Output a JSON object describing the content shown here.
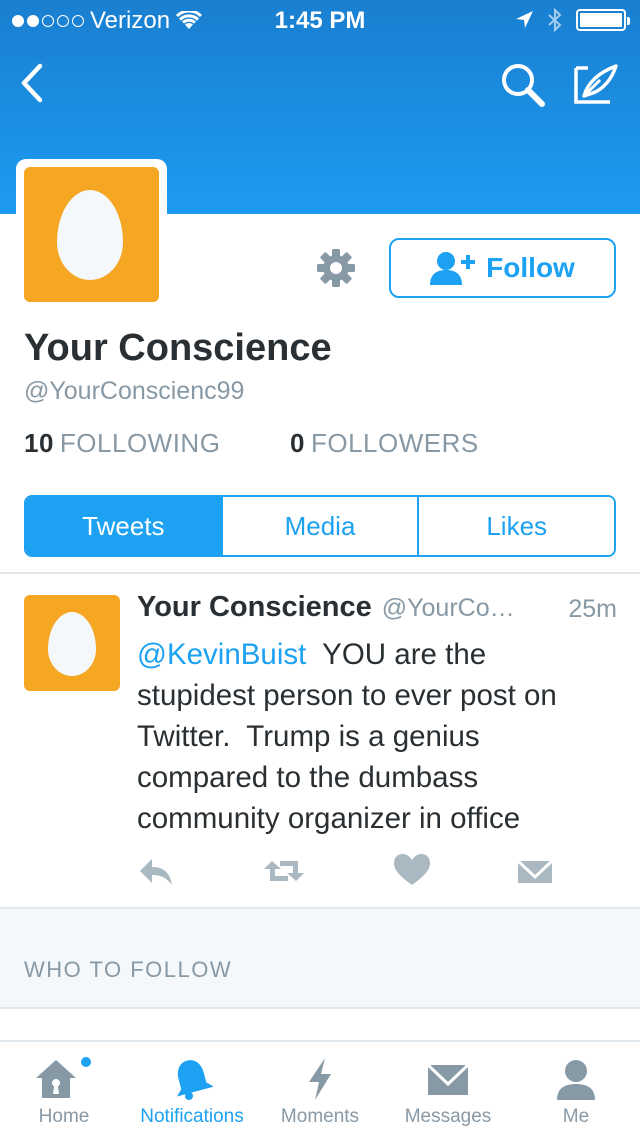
{
  "status_bar": {
    "carrier": "Verizon",
    "time": "1:45 PM",
    "signal_icon": "signal-dots-icon",
    "wifi_icon": "wifi-icon",
    "location_icon": "location-arrow-icon",
    "bluetooth_icon": "bluetooth-icon",
    "battery_icon": "battery-icon"
  },
  "nav": {
    "back_icon": "chevron-left-icon",
    "search_icon": "search-icon",
    "compose_icon": "compose-tweet-icon"
  },
  "profile": {
    "name": "Your Conscience",
    "handle": "@YourConscienc99",
    "following_count": "10",
    "following_label": "FOLLOWING",
    "followers_count": "0",
    "followers_label": "FOLLOWERS",
    "follow_button_label": "Follow",
    "settings_icon": "gear-icon",
    "avatar_icon": "egg-avatar"
  },
  "tabs": [
    {
      "label": "Tweets",
      "active": true
    },
    {
      "label": "Media",
      "active": false
    },
    {
      "label": "Likes",
      "active": false
    }
  ],
  "tweet": {
    "name": "Your Conscience",
    "handle": "@YourCo…",
    "time": "25m",
    "mention": "@KevinBuist",
    "text": "  YOU are the stupidest person to ever post on Twitter.  Trump is a genius compared to the dumbass community organizer in office",
    "actions": [
      "reply-icon",
      "retweet-icon",
      "like-heart-icon",
      "direct-message-icon"
    ]
  },
  "who_to_follow": {
    "label": "WHO TO FOLLOW"
  },
  "tab_bar": [
    {
      "label": "Home",
      "icon": "home-icon",
      "active": false,
      "badge": true
    },
    {
      "label": "Notifications",
      "icon": "bell-icon",
      "active": true,
      "badge": false
    },
    {
      "label": "Moments",
      "icon": "lightning-icon",
      "active": false,
      "badge": false
    },
    {
      "label": "Messages",
      "icon": "envelope-icon",
      "active": false,
      "badge": false
    },
    {
      "label": "Me",
      "icon": "person-icon",
      "active": false,
      "badge": false
    }
  ],
  "colors": {
    "brand_blue": "#1da1f2",
    "banner_top": "#1a7fd0",
    "avatar_orange": "#f5a623",
    "muted_text": "#8899a6",
    "icon_gray": "#aab8c2"
  }
}
